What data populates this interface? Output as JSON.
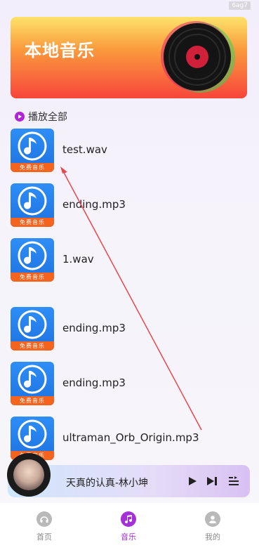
{
  "status_badge": "6ag7",
  "banner": {
    "title": "本地音乐"
  },
  "play_all": {
    "label": "播放全部"
  },
  "cover_band_text": "免费音乐",
  "songs": [
    {
      "name": "test.wav"
    },
    {
      "name": "ending.mp3"
    },
    {
      "name": "1.wav"
    },
    {
      "name": "ending.mp3"
    },
    {
      "name": "ending.mp3"
    },
    {
      "name": "ultraman_Orb_Origin.mp3"
    }
  ],
  "player": {
    "title": "天真的认真-林小坤"
  },
  "tabs": [
    {
      "label": "首页",
      "icon": "headphones-icon"
    },
    {
      "label": "音乐",
      "icon": "music-note-icon",
      "active": true
    },
    {
      "label": "我的",
      "icon": "user-icon"
    }
  ],
  "colors": {
    "accent": "#a52fd9",
    "cover_blue": "#1e72e0",
    "cover_band": "#f5641f",
    "arrow": "#e8474d"
  }
}
